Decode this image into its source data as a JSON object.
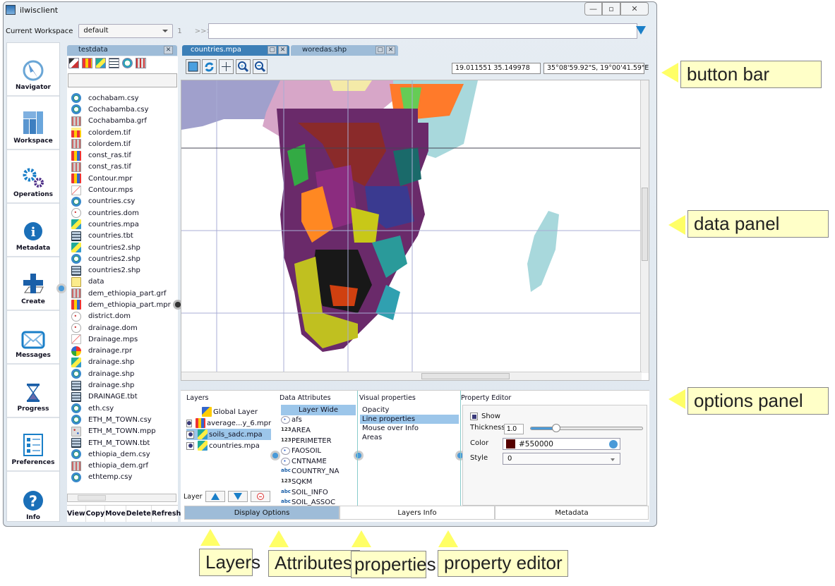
{
  "window": {
    "title": "ilwisclient",
    "controls": [
      "minimize",
      "maximize",
      "close"
    ]
  },
  "workspace_bar": {
    "label": "Current Workspace",
    "selected": "default",
    "index": "1",
    "prompt": ">>>",
    "command_value": ""
  },
  "sidebar": {
    "items": [
      {
        "label": "Navigator",
        "icon": "compass-icon"
      },
      {
        "label": "Workspace",
        "icon": "workspace-icon"
      },
      {
        "label": "Operations",
        "icon": "gears-icon"
      },
      {
        "label": "Metadata",
        "icon": "info-icon"
      },
      {
        "label": "Create",
        "icon": "plus-icon"
      },
      {
        "label": "Messages",
        "icon": "envelope-icon"
      },
      {
        "label": "Progress",
        "icon": "hourglass-icon"
      },
      {
        "label": "Preferences",
        "icon": "list-icon"
      },
      {
        "label": "Info",
        "icon": "question-icon"
      }
    ]
  },
  "catalog": {
    "tab": "testdata",
    "filter_value": "",
    "files": [
      {
        "name": "cochabam.csy",
        "type": "csy"
      },
      {
        "name": "Cochabamba.csy",
        "type": "csy"
      },
      {
        "name": "Cochabamba.grf",
        "type": "grf"
      },
      {
        "name": "colordem.tif",
        "type": "mpr-folder"
      },
      {
        "name": "colordem.tif",
        "type": "grf"
      },
      {
        "name": "const_ras.tif",
        "type": "mpr"
      },
      {
        "name": "const_ras.tif",
        "type": "grf"
      },
      {
        "name": "Contour.mpr",
        "type": "mpr"
      },
      {
        "name": "Contour.mps",
        "type": "mps"
      },
      {
        "name": "countries.csy",
        "type": "csy"
      },
      {
        "name": "countries.dom",
        "type": "dom"
      },
      {
        "name": "countries.mpa",
        "type": "mpa"
      },
      {
        "name": "countries.tbt",
        "type": "tbt"
      },
      {
        "name": "countries2.shp",
        "type": "mpa"
      },
      {
        "name": "countries2.shp",
        "type": "csy"
      },
      {
        "name": "countries2.shp",
        "type": "tbt"
      },
      {
        "name": "data",
        "type": "folder"
      },
      {
        "name": "dem_ethiopia_part.grf",
        "type": "grf"
      },
      {
        "name": "dem_ethiopia_part.mpr",
        "type": "mpr"
      },
      {
        "name": "district.dom",
        "type": "dom"
      },
      {
        "name": "drainage.dom",
        "type": "dom"
      },
      {
        "name": "Drainage.mps",
        "type": "mps"
      },
      {
        "name": "drainage.rpr",
        "type": "rpr"
      },
      {
        "name": "drainage.shp",
        "type": "mpa"
      },
      {
        "name": "drainage.shp",
        "type": "csy"
      },
      {
        "name": "drainage.shp",
        "type": "tbt"
      },
      {
        "name": "DRAINAGE.tbt",
        "type": "tbt"
      },
      {
        "name": "eth.csy",
        "type": "csy"
      },
      {
        "name": "ETH_M_TOWN.csy",
        "type": "csy"
      },
      {
        "name": "ETH_M_TOWN.mpp",
        "type": "mpp"
      },
      {
        "name": "ETH_M_TOWN.tbt",
        "type": "tbt"
      },
      {
        "name": "ethiopia_dem.csy",
        "type": "csy"
      },
      {
        "name": "ethiopia_dem.grf",
        "type": "grf"
      },
      {
        "name": "ethtemp.csy",
        "type": "csy"
      }
    ],
    "buttons": [
      "View",
      "Copy",
      "Move",
      "Delete",
      "Refresh"
    ]
  },
  "map_tabs": [
    {
      "label": "countries.mpa",
      "active": true
    },
    {
      "label": "woredas.shp",
      "active": false
    }
  ],
  "map_toolbar": {
    "buttons": [
      "zoom-extent",
      "refresh",
      "pan",
      "zoom-in",
      "zoom-out"
    ],
    "coord_xy": "19.011551  35.149978",
    "coord_latlon": "35°08'59.92\"S, 19°00'41.59\"E"
  },
  "options": {
    "layers_header": "Layers",
    "layers": [
      {
        "name": "Global Layer",
        "checked": null,
        "selected": false
      },
      {
        "name": "average...y_6.mpr",
        "checked": true,
        "selected": false
      },
      {
        "name": "soils_sadc.mpa",
        "checked": true,
        "selected": true
      },
      {
        "name": "countries.mpa",
        "checked": true,
        "selected": false
      }
    ],
    "layer_label": "Layer",
    "attributes_header": "Data Attributes",
    "attributes": [
      {
        "name": "Layer Wide",
        "kind": "",
        "selected": true
      },
      {
        "name": "afs",
        "kind": "dom"
      },
      {
        "name": "AREA",
        "kind": "123"
      },
      {
        "name": "PERIMETER",
        "kind": "123"
      },
      {
        "name": "FAOSOIL",
        "kind": "dom"
      },
      {
        "name": "CNTNAME",
        "kind": "dom"
      },
      {
        "name": "COUNTRY_NA",
        "kind": "abc"
      },
      {
        "name": "SQKM",
        "kind": "123"
      },
      {
        "name": "SOIL_INFO",
        "kind": "abc"
      },
      {
        "name": "SOIL_ASSOC",
        "kind": "abc"
      }
    ],
    "visual_header": "Visual properties",
    "visual": [
      {
        "name": "Opacity",
        "selected": false
      },
      {
        "name": "Line properties",
        "selected": true
      },
      {
        "name": "Mouse over Info",
        "selected": false
      },
      {
        "name": "Areas",
        "selected": false
      }
    ],
    "editor_header": "Property Editor",
    "editor": {
      "show_label": "Show",
      "show_checked": true,
      "thickness_label": "Thickness",
      "thickness_value": "1.0",
      "thickness_slider_fraction": 0.1,
      "color_label": "Color",
      "color_value": "#550000",
      "style_label": "Style",
      "style_value": "0"
    },
    "bottom_tabs": [
      {
        "label": "Display Options",
        "active": true
      },
      {
        "label": "Layers Info",
        "active": false
      },
      {
        "label": "Metadata",
        "active": false
      }
    ]
  },
  "callouts": {
    "button_bar": "button bar",
    "data_panel": "data panel",
    "options_panel": "options panel",
    "layers": "Layers",
    "attributes": "Attributes",
    "properties": "properties",
    "property_editor": "property editor"
  },
  "colors": {
    "accent": "#1a7fc8",
    "tab_active": "#3c7fb7",
    "tab_inactive": "#9ebcd8",
    "selection": "#9cc6ea",
    "callout_bg": "#ffffc8"
  }
}
